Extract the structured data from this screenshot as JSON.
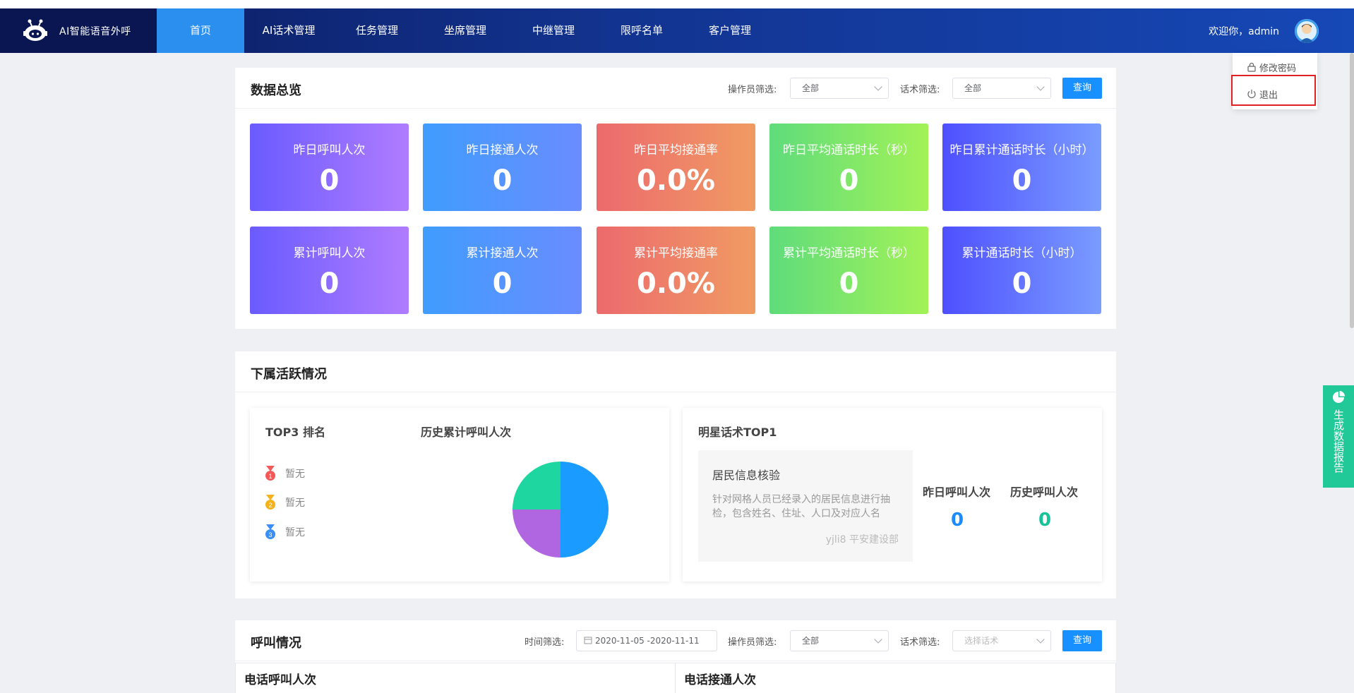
{
  "app": {
    "name": "AI智能语音外呼"
  },
  "nav": {
    "items": [
      {
        "label": "首页",
        "active": true
      },
      {
        "label": "AI话术管理"
      },
      {
        "label": "任务管理"
      },
      {
        "label": "坐席管理"
      },
      {
        "label": "中继管理"
      },
      {
        "label": "限呼名单"
      },
      {
        "label": "客户管理"
      }
    ],
    "welcome": "欢迎你，admin"
  },
  "user_menu": {
    "change_password": "修改密码",
    "logout": "退出"
  },
  "overview": {
    "title": "数据总览",
    "operator_filter_label": "操作员筛选:",
    "operator_filter_value": "全部",
    "script_filter_label": "话术筛选:",
    "script_filter_value": "全部",
    "query_button": "查询",
    "cards": [
      {
        "label": "昨日呼叫人次",
        "value": "0"
      },
      {
        "label": "昨日接通人次",
        "value": "0"
      },
      {
        "label": "昨日平均接通率",
        "value": "0.0%"
      },
      {
        "label": "昨日平均通话时长（秒）",
        "value": "0"
      },
      {
        "label": "昨日累计通话时长（小时）",
        "value": "0"
      },
      {
        "label": "累计呼叫人次",
        "value": "0"
      },
      {
        "label": "累计接通人次",
        "value": "0"
      },
      {
        "label": "累计平均接通率",
        "value": "0.0%"
      },
      {
        "label": "累计平均通话时长（秒）",
        "value": "0"
      },
      {
        "label": "累计通话时长（小时）",
        "value": "0"
      }
    ]
  },
  "activity": {
    "title": "下属活跃情况",
    "top3": {
      "title": "TOP3 排名",
      "entries": [
        "暂无",
        "暂无",
        "暂无"
      ],
      "medal_colors": [
        "#f25a5a",
        "#f5b21a",
        "#3a8ef6"
      ]
    },
    "history_chart_title": "历史累计呼叫人次",
    "star_script": {
      "title": "明星话术TOP1",
      "name": "居民信息核验",
      "description": "针对网格人员已经录入的居民信息进行抽检，包含姓名、住址、人口及对应人名",
      "author": "yjli8 平安建设部",
      "yesterday_label": "昨日呼叫人次",
      "yesterday_value": "0",
      "history_label": "历史呼叫人次",
      "history_value": "0"
    }
  },
  "chart_data": {
    "type": "pie",
    "title": "",
    "slices": [
      {
        "value": 50,
        "color": "#1a9bff"
      },
      {
        "value": 25,
        "color": "#b066e0"
      },
      {
        "value": 25,
        "color": "#1ed6a0"
      }
    ]
  },
  "calls": {
    "title": "呼叫情况",
    "time_filter_label": "时间筛选:",
    "time_filter_value": "2020-11-05 -2020-11-11",
    "operator_filter_label": "操作员筛选:",
    "operator_filter_value": "全部",
    "script_filter_label": "话术筛选:",
    "script_filter_placeholder": "选择话术",
    "query_button": "查询",
    "col_left": "电话呼叫人次",
    "col_right": "电话接通人次"
  },
  "side_tab": {
    "label": "生成数据报告"
  }
}
